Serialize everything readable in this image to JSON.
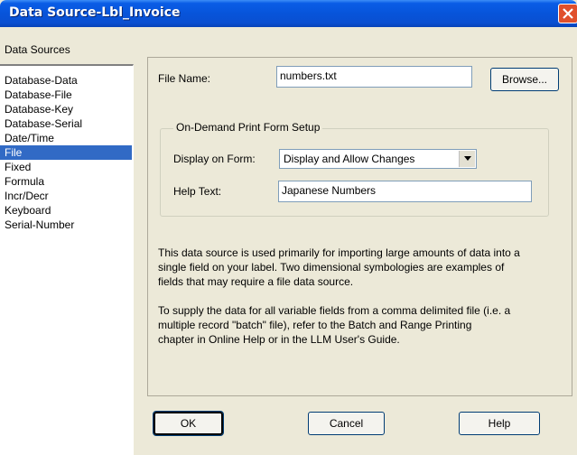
{
  "window": {
    "title": "Data Source-Lbl_Invoice"
  },
  "sidebar": {
    "heading": "Data Sources",
    "items": [
      {
        "label": "Database-Data"
      },
      {
        "label": "Database-File"
      },
      {
        "label": "Database-Key"
      },
      {
        "label": "Database-Serial"
      },
      {
        "label": "Date/Time"
      },
      {
        "label": "File"
      },
      {
        "label": "Fixed"
      },
      {
        "label": "Formula"
      },
      {
        "label": "Incr/Decr"
      },
      {
        "label": "Keyboard"
      },
      {
        "label": "Serial-Number"
      }
    ],
    "selected": "File"
  },
  "file": {
    "label": "File Name:",
    "value": "numbers.txt",
    "browse_label": "Browse..."
  },
  "group": {
    "title": "On-Demand Print Form Setup",
    "display_label": "Display on Form:",
    "display_value": "Display and Allow Changes",
    "help_label": "Help Text:",
    "help_value": "Japanese Numbers"
  },
  "description": {
    "p1_lines": [
      "This data source is used primarily for importing large amounts of data into a",
      "single field on your label.  Two dimensional symbologies are examples of",
      "fields that may require a file data source."
    ],
    "p2_lines": [
      "To supply the data for all variable fields from a comma delimited file (i.e. a",
      "multiple record \"batch\" file), refer to  the Batch and Range Printing",
      "chapter in Online Help or in the LLM User's Guide."
    ]
  },
  "buttons": {
    "ok": "OK",
    "cancel": "Cancel",
    "help": "Help"
  },
  "icons": {
    "close": "close-icon",
    "dropdown": "chevron-down-icon"
  }
}
